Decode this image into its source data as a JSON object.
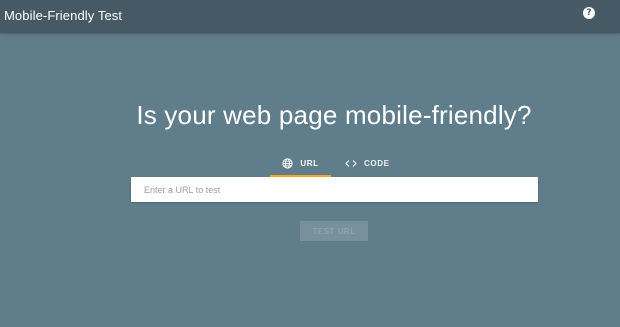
{
  "header": {
    "title": "Mobile-Friendly Test",
    "help_icon": "help-circle-icon",
    "help_glyph": "?"
  },
  "main": {
    "headline": "Is your web page mobile-friendly?",
    "tabs": [
      {
        "label": "URL",
        "icon": "globe-icon",
        "selected": true
      },
      {
        "label": "CODE",
        "icon": "code-brackets-icon",
        "selected": false
      }
    ],
    "url_input": {
      "value": "",
      "placeholder": "Enter a URL to test"
    },
    "test_button": {
      "label": "TEST URL",
      "enabled": false
    }
  },
  "colors": {
    "background": "#607d8b",
    "topbar": "#455a64",
    "tab_indicator": "#f9a825"
  }
}
